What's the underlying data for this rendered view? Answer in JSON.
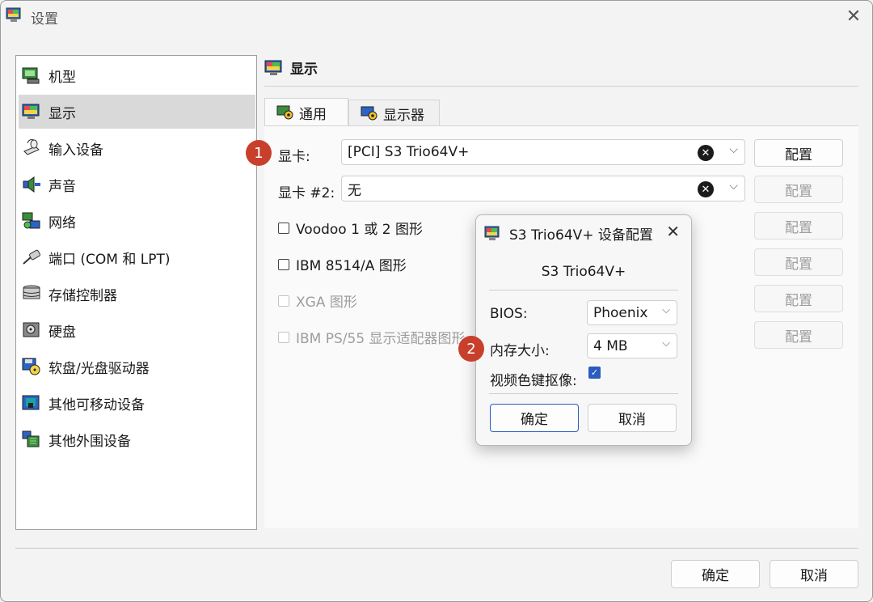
{
  "window": {
    "title": "设置",
    "close_glyph": "✕"
  },
  "sidebar": {
    "items": [
      {
        "label": "机型",
        "icon": "machine-icon"
      },
      {
        "label": "显示",
        "icon": "display-icon"
      },
      {
        "label": "输入设备",
        "icon": "input-device-icon"
      },
      {
        "label": "声音",
        "icon": "speaker-icon"
      },
      {
        "label": "网络",
        "icon": "network-icon"
      },
      {
        "label": "端口 (COM 和 LPT)",
        "icon": "port-icon"
      },
      {
        "label": "存储控制器",
        "icon": "storage-controller-icon"
      },
      {
        "label": "硬盘",
        "icon": "hard-disk-icon"
      },
      {
        "label": "软盘/光盘驱动器",
        "icon": "floppy-cdrom-icon"
      },
      {
        "label": "其他可移动设备",
        "icon": "removable-device-icon"
      },
      {
        "label": "其他外围设备",
        "icon": "peripheral-icon"
      }
    ],
    "selected_index": 1
  },
  "main": {
    "section_title": "显示",
    "tabs": [
      {
        "label": "通用",
        "active": true
      },
      {
        "label": "显示器",
        "active": false
      }
    ],
    "video_card": {
      "label": "显卡:",
      "value": "[PCI] S3 Trio64V+",
      "configure": "配置"
    },
    "video_card2": {
      "label": "显卡 #2:",
      "value": "无",
      "configure": "配置"
    },
    "checkboxes": [
      {
        "label": "Voodoo 1 或 2 图形",
        "checked": false,
        "enabled": true,
        "configure": "配置"
      },
      {
        "label": "IBM 8514/A 图形",
        "checked": false,
        "enabled": true,
        "configure": "配置"
      },
      {
        "label": "XGA 图形",
        "checked": false,
        "enabled": false,
        "configure": "配置"
      },
      {
        "label": "IBM PS/55 显示适配器图形",
        "checked": false,
        "enabled": false,
        "configure": "配置"
      }
    ],
    "markers": [
      "1",
      "2"
    ]
  },
  "dialog": {
    "title": "S3 Trio64V+ 设备配置",
    "subtitle": "S3 Trio64V+",
    "bios_label": "BIOS:",
    "bios_value": "Phoenix",
    "memory_label": "内存大小:",
    "memory_value": "4 MB",
    "chroma_label": "视频色键抠像:",
    "chroma_checked": true,
    "ok": "确定",
    "cancel": "取消"
  },
  "footer": {
    "ok": "确定",
    "cancel": "取消"
  },
  "colors": {
    "accent": "#2b5cbf",
    "marker": "#c8402b",
    "selected": "#d9d9d9"
  }
}
